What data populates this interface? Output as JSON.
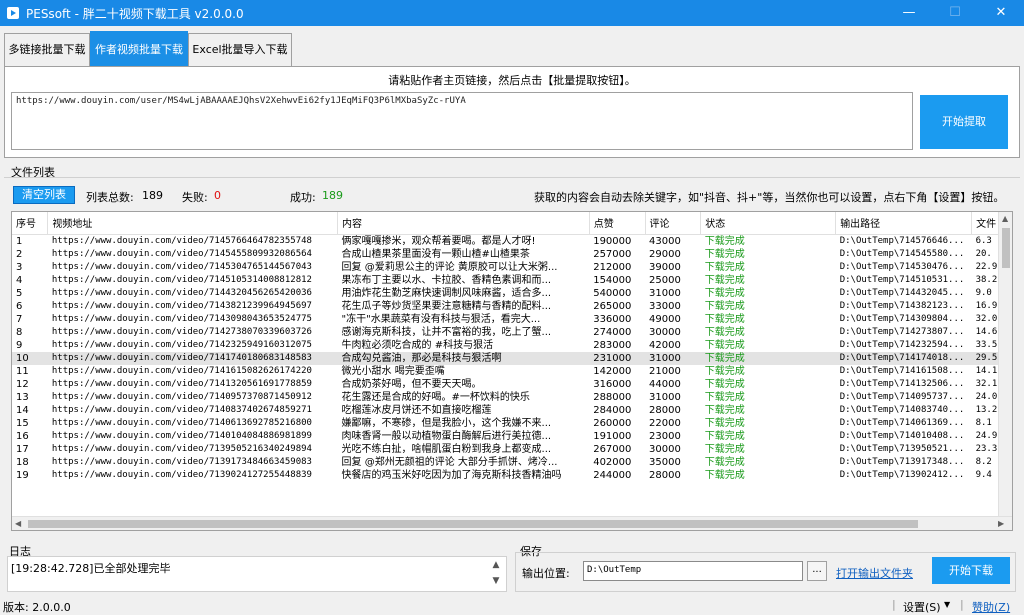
{
  "window": {
    "title": "PESsoft - 胖二十视频下载工具 v2.0.0.0",
    "min_glyph": "—",
    "max_glyph": "☐",
    "close_glyph": "✕",
    "brand_color": "#1989e6"
  },
  "tabs": [
    {
      "label": "多链接批量下载",
      "active": false
    },
    {
      "label": "作者视频批量下载",
      "active": true
    },
    {
      "label": "Excel批量导入下载",
      "active": false
    }
  ],
  "author_panel": {
    "instruction": "请粘贴作者主页链接，然后点击【批量提取按钮】。",
    "url_value": "https://www.douyin.com/user/MS4wLjABAAAAEJQhsV2XehwvEi62fy1JEqMiFQ3P6lMXbaSyZc-rUYA",
    "extract_button": "开始提取"
  },
  "file_list": {
    "section_title": "文件列表",
    "clear_button": "清空列表",
    "total_label": "列表总数:",
    "total_value": "189",
    "fail_label": "失败:",
    "fail_value": "0",
    "success_label": "成功:",
    "success_value": "189",
    "hint": "获取的内容会自动去除关键字，如\"抖音、抖+\"等，当然你也可以设置，点右下角【设置】按钮。",
    "columns": [
      "序号",
      "视频地址",
      "内容",
      "点赞",
      "评论",
      "状态",
      "输出路径",
      "文件"
    ],
    "rows": [
      [
        "1",
        "https://www.douyin.com/video/7145766464782355748",
        "俩家嘎嘎掺米，观众帮着要喝。都是人才呀!",
        "190000",
        "43000",
        "下载完成",
        "D:\\OutTemp\\714576646...",
        "6.3"
      ],
      [
        "2",
        "https://www.douyin.com/video/7145455809932086564",
        "合成山楂果茶里面没有一颗山楂#山楂果茶",
        "257000",
        "29000",
        "下载完成",
        "D:\\OutTemp\\714545580...",
        "20."
      ],
      [
        "3",
        "https://www.douyin.com/video/7145304765144567043",
        "回复 @爱莉思公主的评论 黄原胶可以让大米粥...",
        "212000",
        "39000",
        "下载完成",
        "D:\\OutTemp\\714530476...",
        "22.9"
      ],
      [
        "4",
        "https://www.douyin.com/video/7145105314008812812",
        "果冻布丁主要以水、卡拉胶、香精色素调和而...",
        "154000",
        "25000",
        "下载完成",
        "D:\\OutTemp\\714510531...",
        "38.2"
      ],
      [
        "5",
        "https://www.douyin.com/video/7144320456265420036",
        "用油炸花生勤芝麻快速调制风味麻酱，适合多...",
        "540000",
        "31000",
        "下载完成",
        "D:\\OutTemp\\714432045...",
        "9.0"
      ],
      [
        "6",
        "https://www.douyin.com/video/7143821239964945697",
        "花生瓜子等炒货坚果要注意糖精与香精的配料...",
        "265000",
        "33000",
        "下载完成",
        "D:\\OutTemp\\714382123...",
        "16.9"
      ],
      [
        "7",
        "https://www.douyin.com/video/7143098043653524775",
        "\"冻干\"水果蔬菜有没有科技与狠活，看完大...",
        "336000",
        "49000",
        "下载完成",
        "D:\\OutTemp\\714309804...",
        "32.0"
      ],
      [
        "8",
        "https://www.douyin.com/video/7142738070339603726",
        "感谢海克斯科技，让并不富裕的我，吃上了蟹...",
        "274000",
        "30000",
        "下载完成",
        "D:\\OutTemp\\714273807...",
        "14.6"
      ],
      [
        "9",
        "https://www.douyin.com/video/7142325949160312075",
        "牛肉粒必须吃合成的  #科技与狠活",
        "283000",
        "42000",
        "下载完成",
        "D:\\OutTemp\\714232594...",
        "33.5"
      ],
      [
        "10",
        "https://www.douyin.com/video/7141740180683148583",
        "合成勾兑酱油，那必是科技与狠活啊",
        "231000",
        "31000",
        "下载完成",
        "D:\\OutTemp\\714174018...",
        "29.5"
      ],
      [
        "11",
        "https://www.douyin.com/video/7141615082626174220",
        "微光小甜水 喝完要歪嘴",
        "142000",
        "21000",
        "下载完成",
        "D:\\OutTemp\\714161508...",
        "14.1"
      ],
      [
        "12",
        "https://www.douyin.com/video/7141320561691778859",
        "合成奶茶好喝，但不要天天喝。",
        "316000",
        "44000",
        "下载完成",
        "D:\\OutTemp\\714132506...",
        "32.1"
      ],
      [
        "13",
        "https://www.douyin.com/video/7140957370871450912",
        "花生露还是合成的好喝。#一杯饮料的快乐",
        "288000",
        "31000",
        "下载完成",
        "D:\\OutTemp\\714095737...",
        "24.0"
      ],
      [
        "14",
        "https://www.douyin.com/video/7140837402674859271",
        "吃榴莲冰皮月饼还不如直接吃榴莲",
        "284000",
        "28000",
        "下载完成",
        "D:\\OutTemp\\714083740...",
        "13.2"
      ],
      [
        "15",
        "https://www.douyin.com/video/7140613692785216800",
        "嫌鄙嘛，不寒碜，但是我脸小，这个我嫌不来...",
        "260000",
        "22000",
        "下载完成",
        "D:\\OutTemp\\714061369...",
        "8.1"
      ],
      [
        "16",
        "https://www.douyin.com/video/7140104084886981899",
        "肉味香肾一般以动植物蛋白酶解后进行美拉德...",
        "191000",
        "23000",
        "下载完成",
        "D:\\OutTemp\\714010408...",
        "24.9"
      ],
      [
        "17",
        "https://www.douyin.com/video/7139505216340249894",
        "光吃不练白扯，啥帽肌蛋白粉到我身上都变成...",
        "267000",
        "30000",
        "下载完成",
        "D:\\OutTemp\\713950521...",
        "23.3"
      ],
      [
        "18",
        "https://www.douyin.com/video/7139173484663459083",
        "回复 @郑州无颜祖的评论 大部分手抓饼、烤冷...",
        "402000",
        "35000",
        "下载完成",
        "D:\\OutTemp\\713917348...",
        "8.2"
      ],
      [
        "19",
        "https://www.douyin.com/video/7139024127255448839",
        "快餐店的鸡玉米好吃因为加了海克斯科技香精油吗",
        "244000",
        "28000",
        "下载完成",
        "D:\\OutTemp\\713902412...",
        "9.4"
      ]
    ],
    "selected_row_index": 9
  },
  "log": {
    "title": "日志",
    "text": "[19:28:42.728]已全部处理完毕"
  },
  "save": {
    "title": "保存",
    "location_label": "输出位置:",
    "path_value": "D:\\OutTemp",
    "browse_label": "...",
    "open_folder_link": "打开输出文件夹",
    "download_button": "开始下载"
  },
  "statusbar": {
    "version": "版本: 2.0.0.0",
    "settings": "设置(S)",
    "help": "赞助(Z)"
  }
}
